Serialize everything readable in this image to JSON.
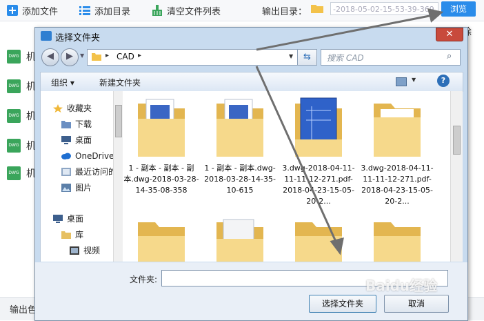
{
  "app": {
    "toolbar": {
      "add_file": "添加文件",
      "add_dir": "添加目录",
      "clear_list": "清空文件列表",
      "output_dir_label": "输出目录：",
      "output_dir_value": "-2018-05-02-15-53-39-369",
      "browse": "浏览"
    },
    "file_rows": [
      {
        "badge": "DWG",
        "name": "机"
      },
      {
        "badge": "DWG",
        "name": "机"
      },
      {
        "badge": "DWG",
        "name": "机"
      },
      {
        "badge": "DWG",
        "name": "机"
      },
      {
        "badge": "DWG",
        "name": "机"
      }
    ],
    "right_fragment": "除",
    "bottom_label": "输出色"
  },
  "dialog": {
    "title": "选择文件夹",
    "close": "✕",
    "address": {
      "segments": [
        "CAD"
      ]
    },
    "search_placeholder": "搜索 CAD",
    "commands": {
      "organize": "组织",
      "new_folder": "新建文件夹"
    },
    "nav_items": [
      {
        "label": "收藏夹",
        "icon": "star-icon"
      },
      {
        "label": "下载",
        "icon": "download-folder-icon"
      },
      {
        "label": "桌面",
        "icon": "desktop-icon"
      },
      {
        "label": "OneDrive",
        "icon": "cloud-icon"
      },
      {
        "label": "最近访问的",
        "icon": "recent-icon"
      },
      {
        "label": "图片",
        "icon": "pictures-icon"
      },
      {
        "label": "桌面",
        "icon": "desktop-icon"
      },
      {
        "label": "库",
        "icon": "library-icon"
      },
      {
        "label": "视频",
        "icon": "video-icon"
      }
    ],
    "files": [
      {
        "label": "1 - 副本 - 副本 - 副本.dwg-2018-03-28-14-35-08-358",
        "kind": "folder-doc"
      },
      {
        "label": "1 - 副本 - 副本.dwg-2018-03-28-14-35-10-615",
        "kind": "folder-doc"
      },
      {
        "label": "3.dwg-2018-04-11-11-11-12-271.pdf-2018-04-23-15-05-20-2...",
        "kind": "folder-blue"
      },
      {
        "label": "3.dwg-2018-04-11-11-11-12-271.pdf-2018-04-23-15-05-20-2...",
        "kind": "folder-plain"
      },
      {
        "label": "",
        "kind": "folder-plain"
      },
      {
        "label": "",
        "kind": "folder-doc"
      },
      {
        "label": "",
        "kind": "folder-plain"
      },
      {
        "label": "",
        "kind": "folder-plain"
      }
    ],
    "folder_label": "文件夹:",
    "folder_value": "",
    "select_button": "选择文件夹",
    "cancel_button": "取消"
  },
  "watermark": "Baidu经验",
  "colors": {
    "accent": "#2a8cea",
    "folder": "#f3d27a",
    "dwg_badge": "#3aa55b"
  }
}
